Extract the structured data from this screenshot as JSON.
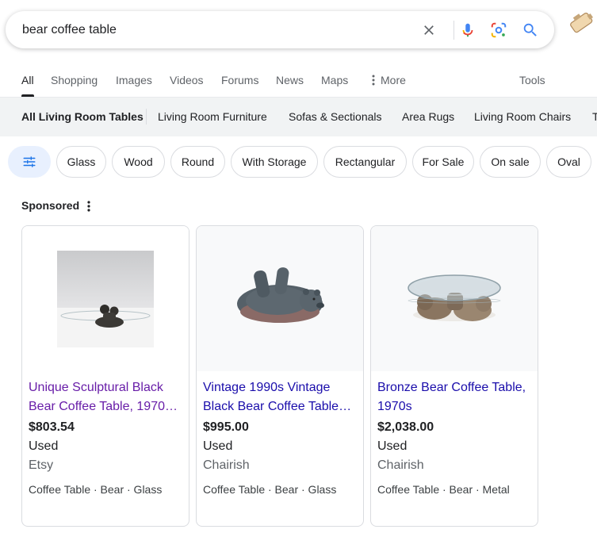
{
  "search": {
    "query": "bear coffee table"
  },
  "tabs": [
    {
      "label": "All"
    },
    {
      "label": "Shopping"
    },
    {
      "label": "Images"
    },
    {
      "label": "Videos"
    },
    {
      "label": "Forums"
    },
    {
      "label": "News"
    },
    {
      "label": "Maps"
    },
    {
      "label": "More"
    },
    {
      "label": "Tools"
    }
  ],
  "subnav": [
    {
      "label": "All Living Room Tables"
    },
    {
      "label": "Living Room Furniture"
    },
    {
      "label": "Sofas & Sectionals"
    },
    {
      "label": "Area Rugs"
    },
    {
      "label": "Living Room Chairs"
    },
    {
      "label": "T"
    }
  ],
  "chips": [
    {
      "label": "Glass"
    },
    {
      "label": "Wood"
    },
    {
      "label": "Round"
    },
    {
      "label": "With Storage"
    },
    {
      "label": "Rectangular"
    },
    {
      "label": "For Sale"
    },
    {
      "label": "On sale"
    },
    {
      "label": "Oval"
    }
  ],
  "sponsored_label": "Sponsored",
  "products": [
    {
      "title": "Unique Sculptural Black Bear Coffee Table, 1970…",
      "price": "$803.54",
      "condition": "Used",
      "seller": "Etsy",
      "tags": "Coffee Table · Bear · Glass"
    },
    {
      "title": "Vintage 1990s Vintage Black Bear Coffee Table…",
      "price": "$995.00",
      "condition": "Used",
      "seller": "Chairish",
      "tags": "Coffee Table · Bear · Glass"
    },
    {
      "title": "Bronze Bear Coffee Table, 1970s",
      "price": "$2,038.00",
      "condition": "Used",
      "seller": "Chairish",
      "tags": "Coffee Table · Bear · Metal"
    }
  ],
  "colors": {
    "link": "#1a0dab",
    "visited_link": "#681da8",
    "search_blue": "#4285f4",
    "mic_red": "#ea4335",
    "filter_chip_bg": "#e8f0fe"
  },
  "icons": {
    "clear": "close-icon",
    "voice": "microphone-icon",
    "lens": "google-lens-icon",
    "search": "search-icon",
    "filter": "sliders-icon",
    "more": "vertical-dots-icon"
  }
}
